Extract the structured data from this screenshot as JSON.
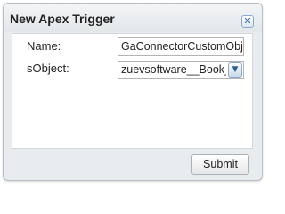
{
  "dialog": {
    "title": "New Apex Trigger",
    "close_glyph": "✕"
  },
  "form": {
    "name_label": "Name:",
    "name_value": "GaConnectorCustomObject",
    "sobject_label": "sObject:",
    "sobject_value": "zuevsoftware__Book__c",
    "dropdown_glyph": "▼"
  },
  "footer": {
    "submit_label": "Submit"
  },
  "icons": {
    "close": "close-icon",
    "dropdown": "chevron-down-icon"
  }
}
